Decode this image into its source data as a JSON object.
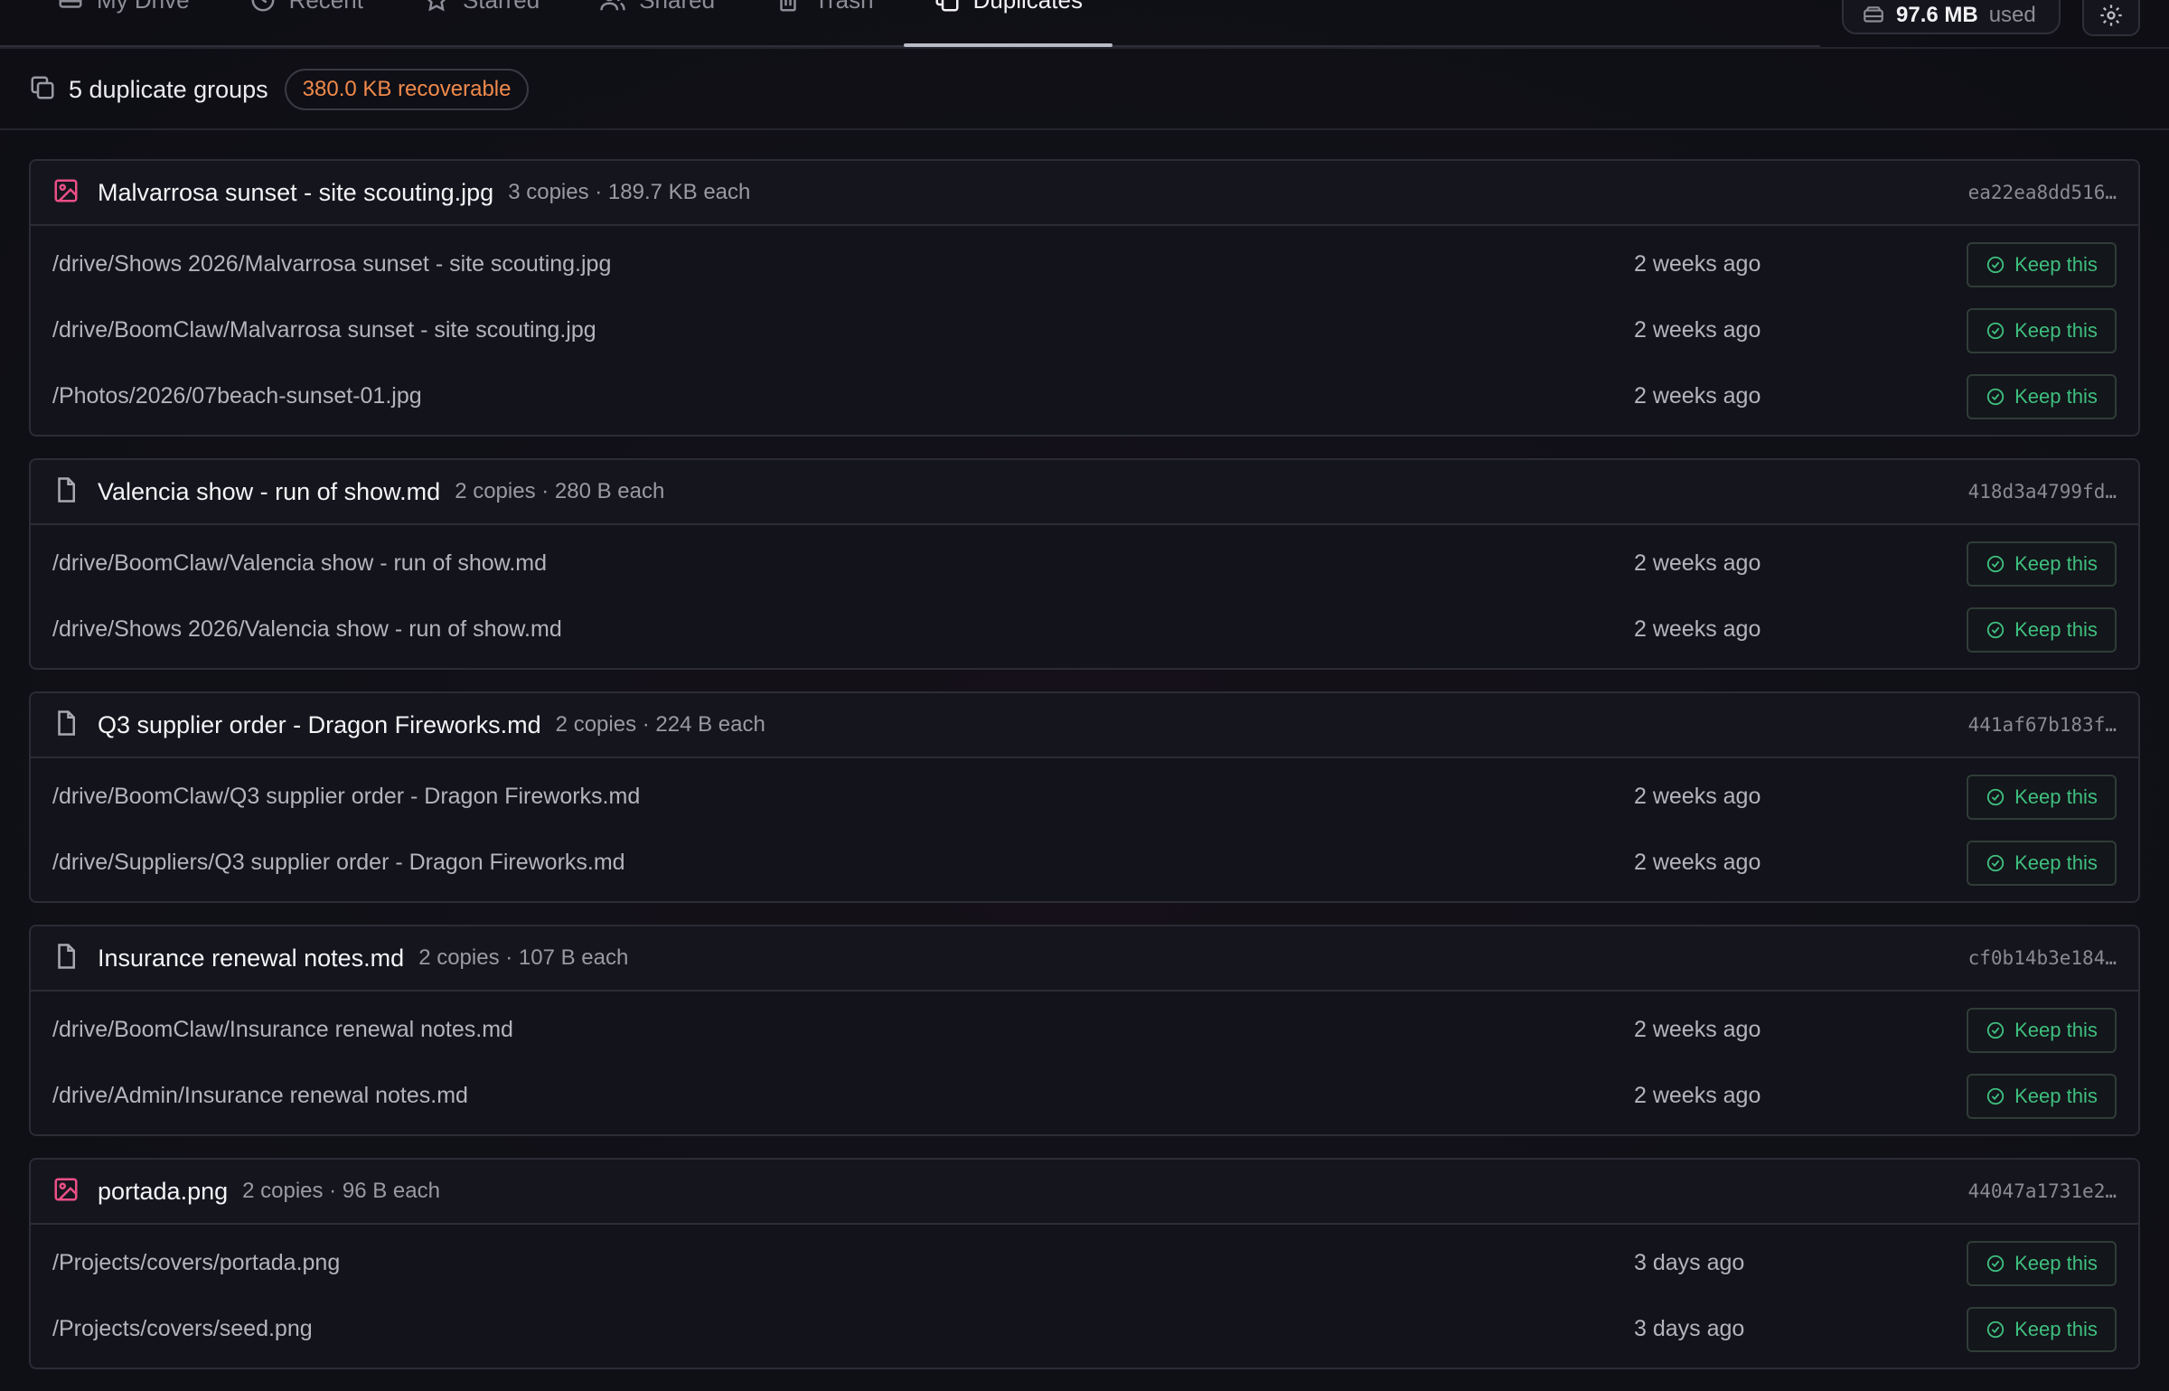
{
  "nav": {
    "tabs": [
      {
        "label": "My Drive",
        "icon": "drive-icon"
      },
      {
        "label": "Recent",
        "icon": "clock-icon"
      },
      {
        "label": "Starred",
        "icon": "star-icon"
      },
      {
        "label": "Shared",
        "icon": "users-icon"
      },
      {
        "label": "Trash",
        "icon": "trash-icon"
      },
      {
        "label": "Duplicates",
        "icon": "duplicates-icon",
        "active": true
      }
    ],
    "storage_value": "97.6 MB",
    "storage_label": "used"
  },
  "summary": {
    "count": "5 duplicate groups",
    "recoverable": "380.0 KB recoverable"
  },
  "keep_label": "Keep this",
  "groups": [
    {
      "name": "Malvarrosa sunset - site scouting.jpg",
      "meta": "3 copies · 189.7 KB each",
      "hash": "ea22ea8dd516…",
      "type": "image",
      "files": [
        {
          "path": "/drive/Shows 2026/Malvarrosa sunset - site scouting.jpg",
          "time": "2 weeks ago"
        },
        {
          "path": "/drive/BoomClaw/Malvarrosa sunset - site scouting.jpg",
          "time": "2 weeks ago"
        },
        {
          "path": "/Photos/2026/07beach-sunset-01.jpg",
          "time": "2 weeks ago"
        }
      ]
    },
    {
      "name": "Valencia show - run of show.md",
      "meta": "2 copies · 280 B each",
      "hash": "418d3a4799fd…",
      "type": "document",
      "files": [
        {
          "path": "/drive/BoomClaw/Valencia show - run of show.md",
          "time": "2 weeks ago"
        },
        {
          "path": "/drive/Shows 2026/Valencia show - run of show.md",
          "time": "2 weeks ago"
        }
      ]
    },
    {
      "name": "Q3 supplier order - Dragon Fireworks.md",
      "meta": "2 copies · 224 B each",
      "hash": "441af67b183f…",
      "type": "document",
      "files": [
        {
          "path": "/drive/BoomClaw/Q3 supplier order - Dragon Fireworks.md",
          "time": "2 weeks ago"
        },
        {
          "path": "/drive/Suppliers/Q3 supplier order - Dragon Fireworks.md",
          "time": "2 weeks ago"
        }
      ]
    },
    {
      "name": "Insurance renewal notes.md",
      "meta": "2 copies · 107 B each",
      "hash": "cf0b14b3e184…",
      "type": "document",
      "files": [
        {
          "path": "/drive/BoomClaw/Insurance renewal notes.md",
          "time": "2 weeks ago"
        },
        {
          "path": "/drive/Admin/Insurance renewal notes.md",
          "time": "2 weeks ago"
        }
      ]
    },
    {
      "name": "portada.png",
      "meta": "2 copies · 96 B each",
      "hash": "44047a1731e2…",
      "type": "image",
      "files": [
        {
          "path": "/Projects/covers/portada.png",
          "time": "3 days ago"
        },
        {
          "path": "/Projects/covers/seed.png",
          "time": "3 days ago"
        }
      ]
    }
  ]
}
